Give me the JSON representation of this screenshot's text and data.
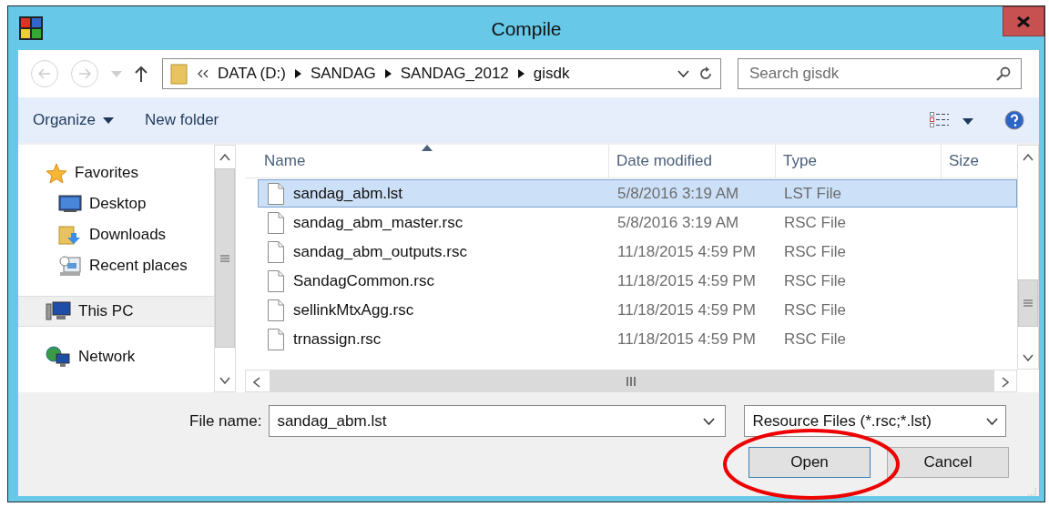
{
  "window": {
    "title": "Compile"
  },
  "address": {
    "crumbs": [
      "DATA (D:)",
      "SANDAG",
      "SANDAG_2012",
      "gisdk"
    ]
  },
  "search": {
    "placeholder": "Search gisdk"
  },
  "toolbar": {
    "items": [
      "Organize",
      "New folder"
    ]
  },
  "nav": [
    {
      "label": "Favorites",
      "kind": "star",
      "selected": false,
      "children": [
        {
          "label": "Desktop",
          "kind": "desktop",
          "selected": false
        },
        {
          "label": "Downloads",
          "kind": "downloads",
          "selected": false
        },
        {
          "label": "Recent places",
          "kind": "recent",
          "selected": false
        }
      ]
    },
    {
      "label": "This PC",
      "kind": "pc",
      "selected": true
    },
    {
      "label": "Network",
      "kind": "network",
      "selected": false
    }
  ],
  "table": {
    "columns": [
      {
        "label": "Name",
        "sorted": true
      },
      {
        "label": "Date modified",
        "sorted": false
      },
      {
        "label": "Type",
        "sorted": false
      },
      {
        "label": "Size",
        "sorted": false
      }
    ],
    "rows": [
      {
        "name": "sandag_abm.lst",
        "date": "5/8/2016 3:19 AM",
        "type": "LST File",
        "selected": true
      },
      {
        "name": "sandag_abm_master.rsc",
        "date": "5/8/2016 3:19 AM",
        "type": "RSC File",
        "selected": false
      },
      {
        "name": "sandag_abm_outputs.rsc",
        "date": "11/18/2015 4:59 PM",
        "type": "RSC File",
        "selected": false
      },
      {
        "name": "SandagCommon.rsc",
        "date": "11/18/2015 4:59 PM",
        "type": "RSC File",
        "selected": false
      },
      {
        "name": "sellinkMtxAgg.rsc",
        "date": "11/18/2015 4:59 PM",
        "type": "RSC File",
        "selected": false
      },
      {
        "name": "trnassign.rsc",
        "date": "11/18/2015 4:59 PM",
        "type": "RSC File",
        "selected": false
      }
    ]
  },
  "file_name": {
    "label": "File name:",
    "value": "sandag_abm.lst"
  },
  "filter": {
    "value": "Resource Files (*.rsc;*.lst)"
  },
  "buttons": [
    {
      "label": "Open",
      "default": true
    },
    {
      "label": "Cancel",
      "default": false
    }
  ],
  "annotation": {
    "kind": "ellipse"
  }
}
